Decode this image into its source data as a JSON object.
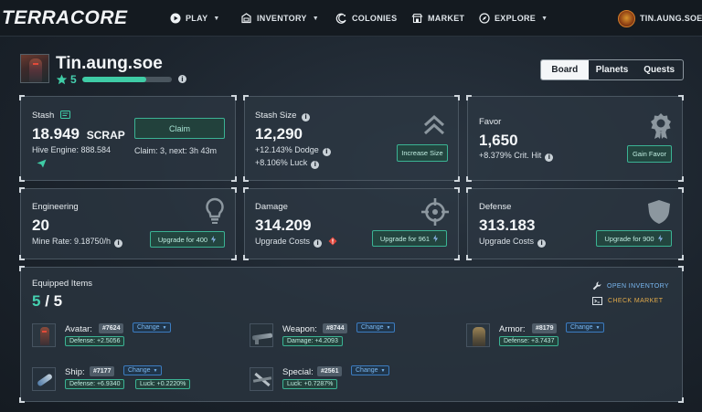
{
  "nav": {
    "logo": "TERRACORE",
    "items": [
      {
        "label": "PLAY",
        "icon": "play-icon",
        "dropdown": true
      },
      {
        "label": "INVENTORY",
        "icon": "inventory-icon",
        "dropdown": true
      },
      {
        "label": "COLONIES",
        "icon": "colonies-icon",
        "dropdown": false
      },
      {
        "label": "MARKET",
        "icon": "market-icon",
        "dropdown": false
      },
      {
        "label": "EXPLORE",
        "icon": "explore-icon",
        "dropdown": true
      }
    ],
    "user": {
      "name": "TIN.AUNG.SOE",
      "icon": "user-avatar-icon",
      "dropdown": true
    }
  },
  "profile": {
    "name": "Tin.aung.soe",
    "level": "5",
    "xp_fraction": 0.71
  },
  "tabs": [
    {
      "label": "Board",
      "active": true
    },
    {
      "label": "Planets",
      "active": false
    },
    {
      "label": "Quests",
      "active": false
    }
  ],
  "stash": {
    "title": "Stash",
    "value": "18.949",
    "unit": "SCRAP",
    "hive": "Hive Engine: 888.584",
    "claim_button": "Claim",
    "claim_info": "Claim: 3, next: 3h 43m"
  },
  "stash_size": {
    "title": "Stash Size",
    "value": "12,290",
    "dodge": "+12.143% Dodge",
    "luck": "+8.106% Luck",
    "button": "Increase Size"
  },
  "favor": {
    "title": "Favor",
    "value": "1,650",
    "crit": "+8.379% Crit. Hit",
    "button": "Gain Favor"
  },
  "engineering": {
    "title": "Engineering",
    "value": "20",
    "rate": "Mine Rate: 9.18750/h",
    "button": "Upgrade for 400"
  },
  "damage": {
    "title": "Damage",
    "value": "314.209",
    "costs": "Upgrade Costs",
    "button": "Upgrade for 961"
  },
  "defense": {
    "title": "Defense",
    "value": "313.183",
    "costs": "Upgrade Costs",
    "button": "Upgrade for 900"
  },
  "equipped": {
    "title": "Equipped Items",
    "count_equipped": "5",
    "count_sep": "/",
    "count_total": "5",
    "open_inventory": "OPEN INVENTORY",
    "check_market": "CHECK MARKET",
    "change_label": "Change",
    "items": [
      {
        "slot": "Avatar:",
        "id": "#7624",
        "stats": [
          "Defense: +2.5056"
        ]
      },
      {
        "slot": "Weapon:",
        "id": "#8744",
        "stats": [
          "Damage: +4.2093"
        ]
      },
      {
        "slot": "Armor:",
        "id": "#8179",
        "stats": [
          "Defense: +3.7437"
        ]
      },
      {
        "slot": "Ship:",
        "id": "#7177",
        "stats": [
          "Defense: +6.9340",
          "Luck: +0.2220%"
        ]
      },
      {
        "slot": "Special:",
        "id": "#2561",
        "stats": [
          "Luck: +0.7287%"
        ]
      }
    ]
  },
  "colors": {
    "accent_green": "#3fcca6",
    "accent_blue": "#3c7cc0",
    "check_market": "#e0a94a",
    "open_inventory": "#79b8f2"
  }
}
